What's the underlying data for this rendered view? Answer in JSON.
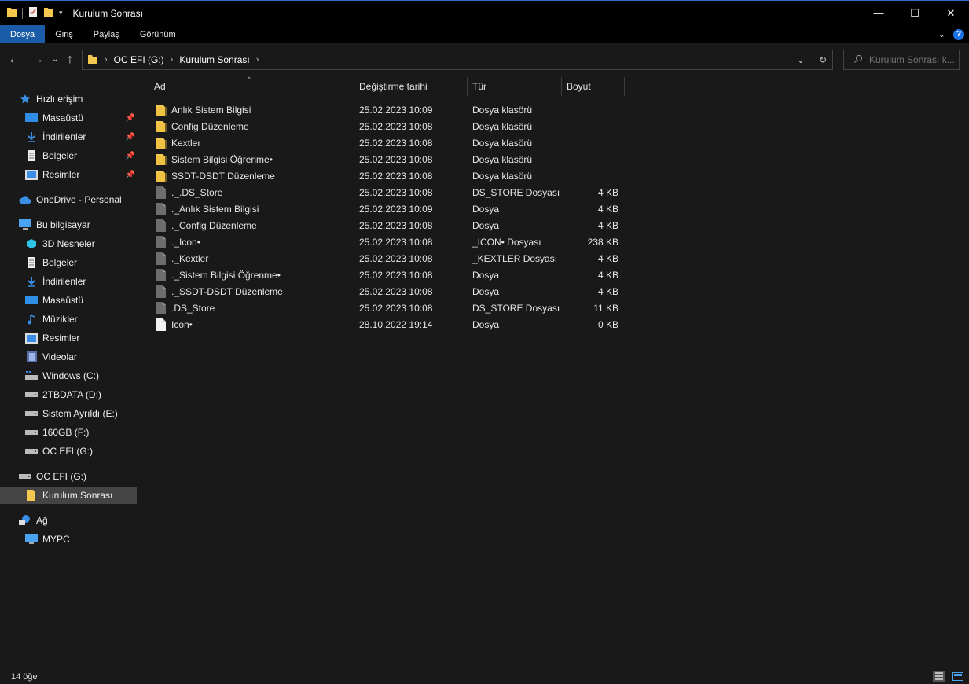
{
  "window": {
    "title": "Kurulum Sonrası",
    "controls": {
      "minimize": "—",
      "maximize": "☐",
      "close": "✕"
    }
  },
  "ribbon": {
    "tabs": [
      "Dosya",
      "Giriş",
      "Paylaş",
      "Görünüm"
    ],
    "active_tab": "Dosya",
    "help": "?"
  },
  "address": {
    "crumbs": [
      "OC EFI (G:)",
      "Kurulum Sonrası"
    ]
  },
  "search": {
    "placeholder": "Kurulum Sonrası k..."
  },
  "nav": {
    "quick_access": "Hızlı erişim",
    "quick_items": [
      "Masaüstü",
      "İndirilenler",
      "Belgeler",
      "Resimler"
    ],
    "onedrive": "OneDrive - Personal",
    "this_pc": "Bu bilgisayar",
    "pc_items": [
      "3D Nesneler",
      "Belgeler",
      "İndirilenler",
      "Masaüstü",
      "Müzikler",
      "Resimler",
      "Videolar",
      "Windows (C:)",
      "2TBDATA (D:)",
      "Sistem Ayrıldı (E:)",
      "160GB (F:)",
      "OC EFI (G:)"
    ],
    "drive": "OC EFI (G:)",
    "drive_child": "Kurulum Sonrası",
    "network": "Ağ",
    "network_items": [
      "MYPC"
    ]
  },
  "columns": {
    "name": "Ad",
    "date": "Değiştirme tarihi",
    "type": "Tür",
    "size": "Boyut"
  },
  "files": [
    {
      "name": "Anlık Sistem Bilgisi",
      "date": "25.02.2023 10:09",
      "type": "Dosya klasörü",
      "size": "",
      "icon": "folder-icon"
    },
    {
      "name": "Config Düzenleme",
      "date": "25.02.2023 10:08",
      "type": "Dosya klasörü",
      "size": "",
      "icon": "folder-icon"
    },
    {
      "name": "Kextler",
      "date": "25.02.2023 10:08",
      "type": "Dosya klasörü",
      "size": "",
      "icon": "folder-icon"
    },
    {
      "name": "Sistem Bilgisi Öğrenme•",
      "date": "25.02.2023 10:08",
      "type": "Dosya klasörü",
      "size": "",
      "icon": "folder-icon"
    },
    {
      "name": "SSDT-DSDT Düzenleme",
      "date": "25.02.2023 10:08",
      "type": "Dosya klasörü",
      "size": "",
      "icon": "folder-icon"
    },
    {
      "name": "._.DS_Store",
      "date": "25.02.2023 10:08",
      "type": "DS_STORE Dosyası",
      "size": "4 KB",
      "icon": "file-icon"
    },
    {
      "name": "._Anlık Sistem Bilgisi",
      "date": "25.02.2023 10:09",
      "type": "Dosya",
      "size": "4 KB",
      "icon": "file-icon"
    },
    {
      "name": "._Config Düzenleme",
      "date": "25.02.2023 10:08",
      "type": "Dosya",
      "size": "4 KB",
      "icon": "file-icon"
    },
    {
      "name": "._Icon•",
      "date": "25.02.2023 10:08",
      "type": "_ICON•  Dosyası",
      "size": "238 KB",
      "icon": "file-icon"
    },
    {
      "name": "._Kextler",
      "date": "25.02.2023 10:08",
      "type": "_KEXTLER Dosyası",
      "size": "4 KB",
      "icon": "file-icon"
    },
    {
      "name": "._Sistem Bilgisi Öğrenme•",
      "date": "25.02.2023 10:08",
      "type": "Dosya",
      "size": "4 KB",
      "icon": "file-icon"
    },
    {
      "name": "._SSDT-DSDT Düzenleme",
      "date": "25.02.2023 10:08",
      "type": "Dosya",
      "size": "4 KB",
      "icon": "file-icon"
    },
    {
      "name": ".DS_Store",
      "date": "25.02.2023 10:08",
      "type": "DS_STORE Dosyası",
      "size": "11 KB",
      "icon": "file-icon"
    },
    {
      "name": "Icon•",
      "date": "28.10.2022 19:14",
      "type": "Dosya",
      "size": "0 KB",
      "icon": "blank-file-icon"
    }
  ],
  "status": {
    "count": "14 öğe"
  },
  "colors": {
    "accent": "#1a5ca8",
    "folder": "#f4c84f",
    "background": "#191919"
  }
}
